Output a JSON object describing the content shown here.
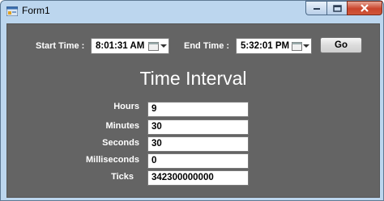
{
  "window": {
    "title": "Form1"
  },
  "form": {
    "start_label": "Start Time :",
    "start_value": "8:01:31 AM",
    "end_label": "End Time :",
    "end_value": "5:32:01 PM",
    "go_label": "Go",
    "heading": "Time Interval",
    "fields": [
      {
        "label": "Hours",
        "value": "9"
      },
      {
        "label": "Minutes",
        "value": "30"
      },
      {
        "label": "Seconds",
        "value": "30"
      },
      {
        "label": "Milliseconds",
        "value": "0"
      },
      {
        "label": "Ticks",
        "value": "342300000000"
      }
    ]
  }
}
